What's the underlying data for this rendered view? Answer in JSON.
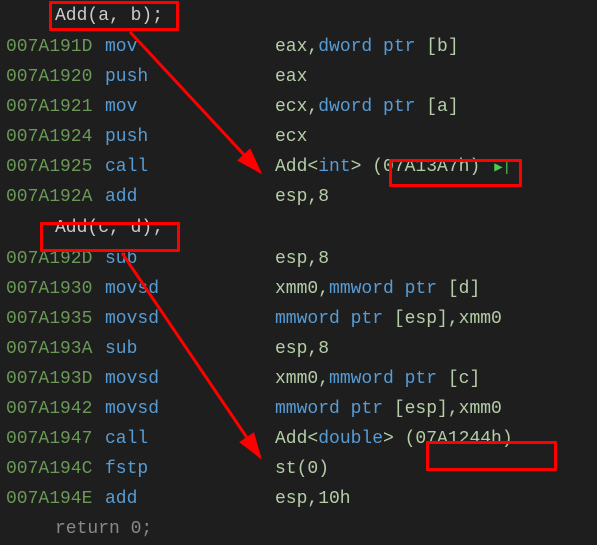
{
  "source1": "Add(a, b);",
  "source2": "Add(c, d);",
  "returnLine": "return 0;",
  "lines": [
    {
      "addr": "007A191D",
      "mnemonic": "mov",
      "op_pre": "eax,",
      "op_kw": "dword ptr ",
      "op_post": "[b]"
    },
    {
      "addr": "007A1920",
      "mnemonic": "push",
      "op_pre": "eax",
      "op_kw": "",
      "op_post": ""
    },
    {
      "addr": "007A1921",
      "mnemonic": "mov",
      "op_pre": "ecx,",
      "op_kw": "dword ptr ",
      "op_post": "[a]"
    },
    {
      "addr": "007A1924",
      "mnemonic": "push",
      "op_pre": "ecx",
      "op_kw": "",
      "op_post": ""
    },
    {
      "addr": "007A1925",
      "mnemonic": "call",
      "op_pre": "Add<",
      "op_kw": "int",
      "op_post": "> (07A13A7h)",
      "marker": true
    },
    {
      "addr": "007A192A",
      "mnemonic": "add",
      "op_pre": "esp,8",
      "op_kw": "",
      "op_post": ""
    }
  ],
  "lines2": [
    {
      "addr": "007A192D",
      "mnemonic": "sub",
      "op_pre": "esp,8",
      "op_kw": "",
      "op_post": ""
    },
    {
      "addr": "007A1930",
      "mnemonic": "movsd",
      "op_pre": "xmm0,",
      "op_kw": "mmword ptr ",
      "op_post": "[d]"
    },
    {
      "addr": "007A1935",
      "mnemonic": "movsd",
      "op_pre": "",
      "op_kw": "mmword ptr ",
      "op_post": "[esp],xmm0"
    },
    {
      "addr": "007A193A",
      "mnemonic": "sub",
      "op_pre": "esp,8",
      "op_kw": "",
      "op_post": ""
    },
    {
      "addr": "007A193D",
      "mnemonic": "movsd",
      "op_pre": "xmm0,",
      "op_kw": "mmword ptr ",
      "op_post": "[c]"
    },
    {
      "addr": "007A1942",
      "mnemonic": "movsd",
      "op_pre": "",
      "op_kw": "mmword ptr ",
      "op_post": "[esp],xmm0"
    },
    {
      "addr": "007A1947",
      "mnemonic": "call",
      "op_pre": "Add<",
      "op_kw": "double",
      "op_post": "> (07A1244h)"
    },
    {
      "addr": "007A194C",
      "mnemonic": "fstp",
      "op_pre": "st(0)",
      "op_kw": "",
      "op_post": ""
    },
    {
      "addr": "007A194E",
      "mnemonic": "add",
      "op_pre": "esp,10h",
      "op_kw": "",
      "op_post": ""
    }
  ]
}
